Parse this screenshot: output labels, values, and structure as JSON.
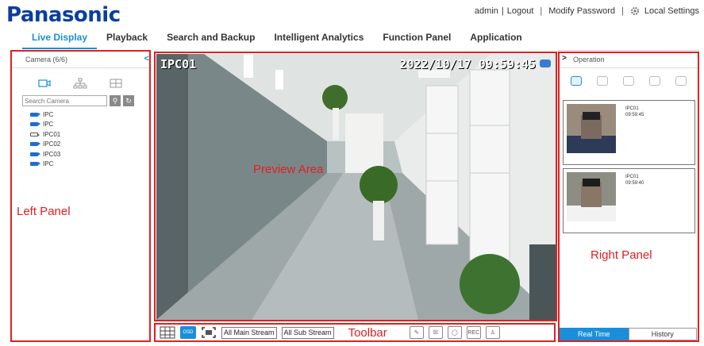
{
  "header": {
    "brand": "Panasonic",
    "user": "admin",
    "logout": "Logout",
    "modify_password": "Modify Password",
    "local_settings": "Local Settings"
  },
  "nav": {
    "tabs": [
      {
        "label": "Live Display",
        "active": true
      },
      {
        "label": "Playback"
      },
      {
        "label": "Search and Backup"
      },
      {
        "label": "Intelligent Analytics"
      },
      {
        "label": "Function Panel"
      },
      {
        "label": "Application"
      }
    ]
  },
  "left_panel": {
    "title": "Camera (6/6)",
    "search_placeholder": "Search Camera",
    "cameras": [
      "IPC",
      "IPC",
      "IPC01",
      "IPC02",
      "IPC03",
      "IPC"
    ],
    "annotation": "Left Panel"
  },
  "preview": {
    "osd_name": "IPC01",
    "osd_time": "2022/10/17 09:59:45",
    "annotation": "Preview Area"
  },
  "toolbar": {
    "osd_label": "OSD",
    "main_stream": "All Main Stream",
    "sub_stream": "All Sub Stream",
    "annotation": "Toolbar",
    "rec_label": "REC"
  },
  "right_panel": {
    "title": "Operation",
    "snapshots": [
      {
        "camera": "IPC01",
        "time": "09:59:45"
      },
      {
        "camera": "IPC01",
        "time": "09:59:40"
      }
    ],
    "annotation": "Right Panel",
    "tabs": [
      "Real Time",
      "History"
    ]
  }
}
